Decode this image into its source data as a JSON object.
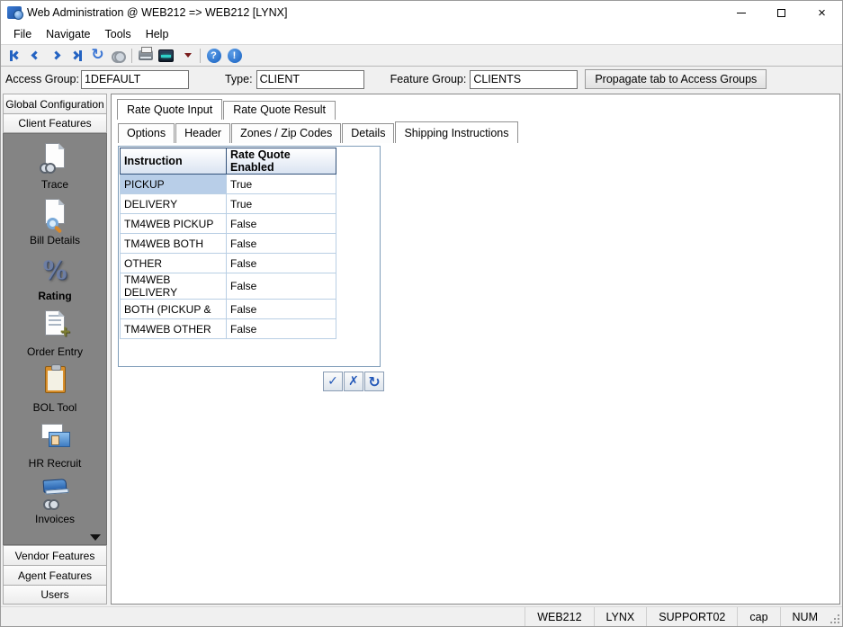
{
  "window": {
    "title": "Web Administration @ WEB212 => WEB212 [LYNX]"
  },
  "menu": {
    "items": [
      "File",
      "Navigate",
      "Tools",
      "Help"
    ]
  },
  "toolbar": {
    "icons": [
      "first-record-icon",
      "previous-record-icon",
      "next-record-icon",
      "last-record-icon",
      "refresh-icon",
      "find-binoculars-icon",
      "print-icon",
      "screen-icon",
      "screen-dropdown-arrow",
      "help-icon",
      "about-icon"
    ],
    "help_glyph": "?",
    "about_glyph": "!",
    "refresh_glyph": "↻"
  },
  "form": {
    "access_group_label": "Access Group:",
    "access_group_value": "1DEFAULT",
    "type_label": "Type:",
    "type_value": "CLIENT",
    "feature_group_label": "Feature Group:",
    "feature_group_value": "CLIENTS",
    "propagate_button": "Propagate tab to Access Groups"
  },
  "sidebar": {
    "top_buttons": [
      "Global Configuration",
      "Client Features"
    ],
    "features": [
      {
        "label": "Trace",
        "selected": false
      },
      {
        "label": "Bill Details",
        "selected": false
      },
      {
        "label": "Rating",
        "selected": true
      },
      {
        "label": "Order Entry",
        "selected": false
      },
      {
        "label": "BOL Tool",
        "selected": false
      },
      {
        "label": "HR Recruit",
        "selected": false
      },
      {
        "label": "Invoices",
        "selected": false
      }
    ],
    "bottom_buttons": [
      "Vendor Features",
      "Agent Features",
      "Users"
    ]
  },
  "main": {
    "tabs": [
      {
        "label": "Rate Quote Input",
        "selected": true
      },
      {
        "label": "Rate Quote Result",
        "selected": false
      }
    ],
    "subtabs": [
      {
        "label": "Options",
        "selected": false
      },
      {
        "label": "Header",
        "selected": false
      },
      {
        "label": "Zones / Zip Codes",
        "selected": false
      },
      {
        "label": "Details",
        "selected": false
      },
      {
        "label": "Shipping Instructions",
        "selected": true
      }
    ],
    "table": {
      "columns": [
        "Instruction",
        "Rate Quote Enabled"
      ],
      "rows": [
        {
          "instruction": "PICKUP",
          "enabled": "True",
          "selected": true
        },
        {
          "instruction": "DELIVERY",
          "enabled": "True",
          "selected": false
        },
        {
          "instruction": "TM4WEB PICKUP",
          "enabled": "False",
          "selected": false
        },
        {
          "instruction": "TM4WEB BOTH",
          "enabled": "False",
          "selected": false
        },
        {
          "instruction": "OTHER",
          "enabled": "False",
          "selected": false
        },
        {
          "instruction": "TM4WEB DELIVERY",
          "enabled": "False",
          "selected": false
        },
        {
          "instruction": "BOTH (PICKUP &",
          "enabled": "False",
          "selected": false
        },
        {
          "instruction": "TM4WEB OTHER",
          "enabled": "False",
          "selected": false
        }
      ]
    },
    "actions": {
      "confirm_glyph": "✓",
      "cancel_glyph": "✗",
      "refresh_glyph": "↻"
    }
  },
  "statusbar": {
    "cells": [
      "WEB212",
      "LYNX",
      "SUPPORT02",
      "cap",
      "NUM"
    ]
  },
  "colors": {
    "accent_blue": "#2463c2",
    "selection_blue": "#b8cee8",
    "sidebar_gray": "#848484",
    "toolbar_bg": "#f0f0f0",
    "grid_border": "#b9cfe4",
    "header_border": "#33527a",
    "groupbox_border": "#7f9db9"
  }
}
